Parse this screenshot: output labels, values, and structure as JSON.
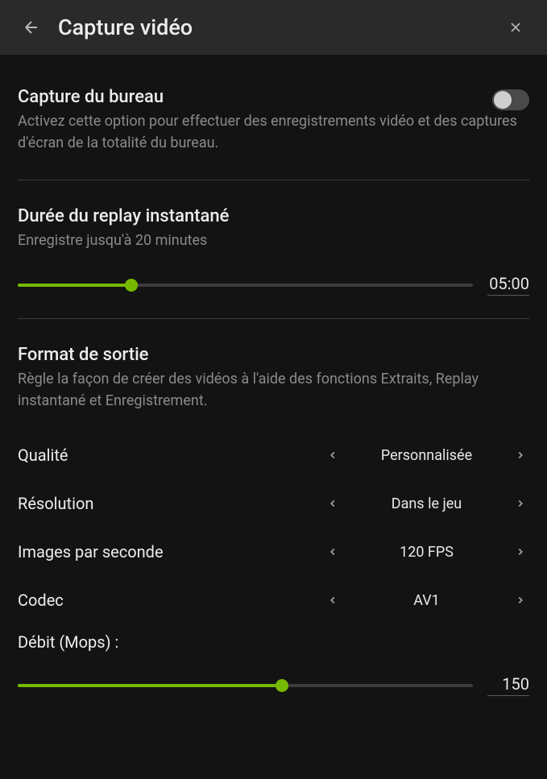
{
  "header": {
    "title": "Capture vidéo"
  },
  "desktop_capture": {
    "title": "Capture du bureau",
    "desc": "Activez cette option pour effectuer des enregistrements vidéo et des captures d'écran de la totalité du bureau."
  },
  "instant_replay": {
    "title": "Durée du replay instantané",
    "desc": "Enregistre jusqu'à 20 minutes",
    "value": "05:00",
    "fill_percent": 25
  },
  "output_format": {
    "title": "Format de sortie",
    "desc": "Règle la façon de créer des vidéos à l'aide des fonctions Extraits, Replay instantané et Enregistrement."
  },
  "quality": {
    "label": "Qualité",
    "value": "Personnalisée"
  },
  "resolution": {
    "label": "Résolution",
    "value": "Dans le jeu"
  },
  "fps": {
    "label": "Images par seconde",
    "value": "120 FPS"
  },
  "codec": {
    "label": "Codec",
    "value": "AV1"
  },
  "bitrate": {
    "label": "Débit (Mops) :",
    "value": "150",
    "fill_percent": 58
  }
}
